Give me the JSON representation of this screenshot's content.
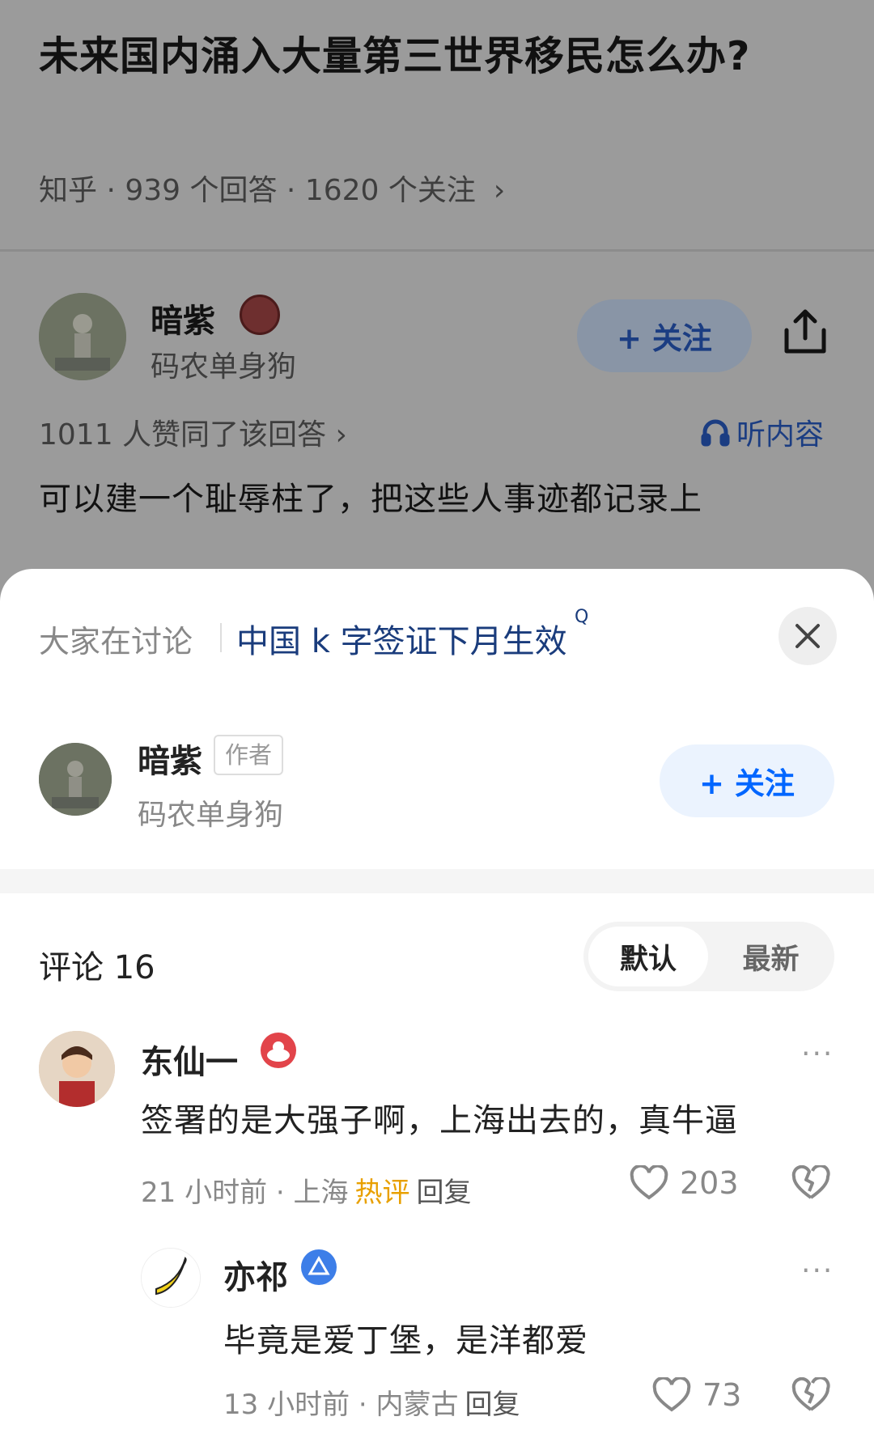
{
  "question": {
    "title": "未来国内涌入大量第三世界移民怎么办?",
    "meta": "知乎 · 939 个回答 · 1620 个关注",
    "chevron": "›"
  },
  "answer_header": {
    "author_name": "暗紫",
    "author_subtitle": "码农单身狗",
    "follow_label": "+ 关注",
    "upvote_summary": "1011 人赞同了该回答 ›",
    "listen_label": "听内容",
    "answer_excerpt": "可以建一个耻辱柱了，把这些人事迹都记录上"
  },
  "sheet": {
    "discuss_label": "大家在讨论",
    "discuss_topic": "中国 k 字签证下月生效",
    "discuss_sup": "Q",
    "author": {
      "name": "暗紫",
      "tag": "作者",
      "subtitle": "码农单身狗",
      "follow_label": "+ 关注"
    },
    "comments_title": "评论 16",
    "sort": {
      "default": "默认",
      "latest": "最新"
    },
    "comments": [
      {
        "name": "东仙一",
        "text": "签署的是大强子啊，上海出去的，真牛逼",
        "time_location": "21 小时前 · 上海",
        "hot": "热评",
        "reply": "回复",
        "likes": "203",
        "more": "···"
      },
      {
        "name": "亦祁",
        "text": "毕竟是爱丁堡，是洋都爱",
        "time_location": "13 小时前 · 内蒙古",
        "reply": "回复",
        "likes": "73",
        "more": "···"
      }
    ]
  },
  "colors": {
    "accent_blue": "#0066ff",
    "hot_orange": "#e8a000",
    "overlay_gray": "#9b9b9b"
  }
}
